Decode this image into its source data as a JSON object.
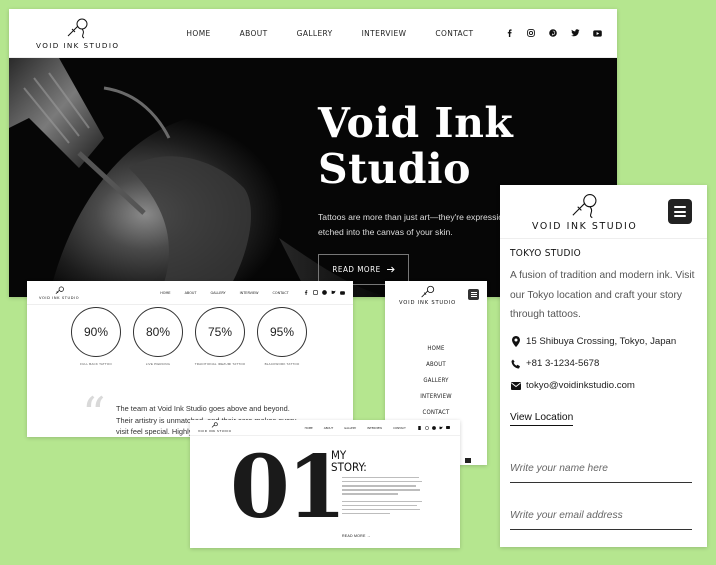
{
  "brand": {
    "name": "VOID INK STUDIO"
  },
  "nav": {
    "items": [
      "HOME",
      "ABOUT",
      "GALLERY",
      "INTERVIEW",
      "CONTACT"
    ]
  },
  "social_icons": [
    "facebook-icon",
    "instagram-icon",
    "pinterest-icon",
    "twitter-icon",
    "youtube-icon"
  ],
  "hero": {
    "title_line1": "Void Ink",
    "title_line2": "Studio",
    "text": "Tattoos are more than just art—they're expressions, stories etched into the canvas of your skin.",
    "button_label": "READ MORE",
    "button_icon": "arrow-right-icon"
  },
  "stats": {
    "items": [
      {
        "value": "90%",
        "level": 0.9,
        "label": "FULL BACK TATTOO"
      },
      {
        "value": "80%",
        "level": 0.8,
        "label": "LIVE PIERCING"
      },
      {
        "value": "75%",
        "level": 0.75,
        "label": "TRADITIONAL IREZUMI TATTOO"
      },
      {
        "value": "95%",
        "level": 0.95,
        "label": "BLACKWORK TATTOO"
      }
    ],
    "testimonial": "The team at Void Ink Studio goes above and beyond. Their artistry is unmatched, and their care makes every visit feel special. Highly recommended!"
  },
  "mobile_menu": {
    "items": [
      "HOME",
      "ABOUT",
      "GALLERY",
      "INTERVIEW",
      "CONTACT"
    ]
  },
  "story": {
    "number": "01",
    "title_line1": "MY",
    "title_line2": "STORY:",
    "read_more": "READ MORE"
  },
  "contact": {
    "title": "TOKYO STUDIO",
    "description": "A fusion of tradition and modern ink. Visit our Tokyo location and craft your story through tattoos.",
    "address": "15 Shibuya Crossing, Tokyo, Japan",
    "phone": "+81 3-1234-5678",
    "email": "tokyo@voidinkstudio.com",
    "view_location": "View Location",
    "name_placeholder": "Write your name here",
    "email_placeholder": "Write your email address"
  },
  "colors": {
    "page_background": "#b5e68f",
    "hero_background": "#060606",
    "text_dark": "#222222",
    "accent": "#111111"
  }
}
